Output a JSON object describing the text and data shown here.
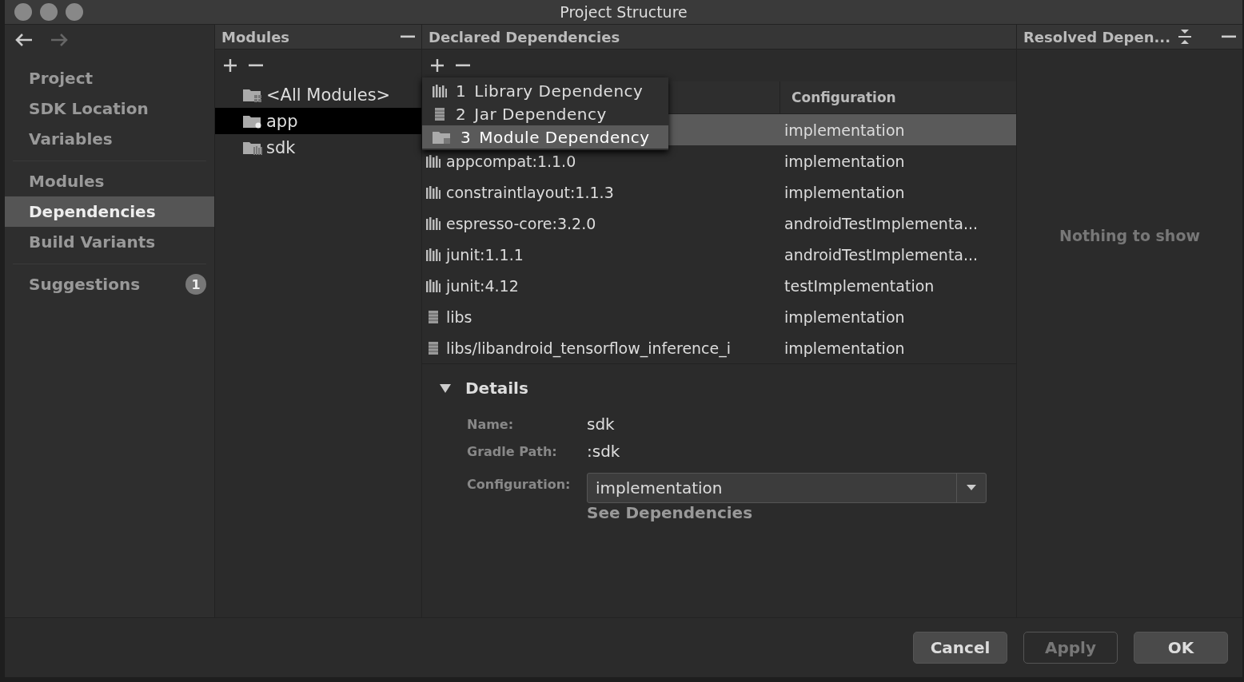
{
  "window": {
    "title": "Project Structure"
  },
  "sidebar": {
    "groups": [
      [
        {
          "label": "Project",
          "selected": false
        },
        {
          "label": "SDK Location",
          "selected": false
        },
        {
          "label": "Variables",
          "selected": false
        }
      ],
      [
        {
          "label": "Modules",
          "selected": false
        },
        {
          "label": "Dependencies",
          "selected": true
        },
        {
          "label": "Build Variants",
          "selected": false
        }
      ],
      [
        {
          "label": "Suggestions",
          "selected": false,
          "badge": "1"
        }
      ]
    ]
  },
  "modules": {
    "title": "Modules",
    "items": [
      {
        "label": "<All Modules>",
        "kind": "all",
        "selected": false
      },
      {
        "label": "app",
        "kind": "app",
        "selected": true
      },
      {
        "label": "sdk",
        "kind": "library",
        "selected": false
      }
    ]
  },
  "declared": {
    "title": "Declared Dependencies",
    "column_header": "Configuration",
    "rows": [
      {
        "configuration": "implementation",
        "selected": true
      },
      {
        "name": "appcompat:1.1.0",
        "configuration": "implementation",
        "kind": "library",
        "selected": false
      },
      {
        "name": "constraintlayout:1.1.3",
        "configuration": "implementation",
        "kind": "library",
        "selected": false
      },
      {
        "name": "espresso-core:3.2.0",
        "configuration": "androidTestImplementa...",
        "kind": "library",
        "selected": false
      },
      {
        "name": "junit:1.1.1",
        "configuration": "androidTestImplementa...",
        "kind": "library",
        "selected": false
      },
      {
        "name": "junit:4.12",
        "configuration": "testImplementation",
        "kind": "library",
        "selected": false
      },
      {
        "name": "libs",
        "configuration": "implementation",
        "kind": "jar",
        "selected": false
      },
      {
        "name": "libs/libandroid_tensorflow_inference_i",
        "configuration": "implementation",
        "kind": "jar",
        "selected": false
      }
    ],
    "menu": [
      {
        "number": "1",
        "label": "Library Dependency",
        "kind": "library",
        "selected": false
      },
      {
        "number": "2",
        "label": "Jar Dependency",
        "kind": "jar",
        "selected": false
      },
      {
        "number": "3",
        "label": "Module Dependency",
        "kind": "module",
        "selected": true
      }
    ],
    "details": {
      "title": "Details",
      "expanded": true,
      "fields": [
        {
          "label": "Name:",
          "value": "sdk"
        },
        {
          "label": "Gradle Path:",
          "value": ":sdk"
        }
      ],
      "configuration": {
        "label": "Configuration:",
        "value": "implementation"
      },
      "link": "See Dependencies"
    }
  },
  "resolved": {
    "title": "Resolved Depen...",
    "empty_text": "Nothing to show"
  },
  "buttons": [
    {
      "label": "Cancel",
      "kind": "normal"
    },
    {
      "label": "Apply",
      "kind": "disabled"
    },
    {
      "label": "OK",
      "kind": "normal"
    }
  ]
}
